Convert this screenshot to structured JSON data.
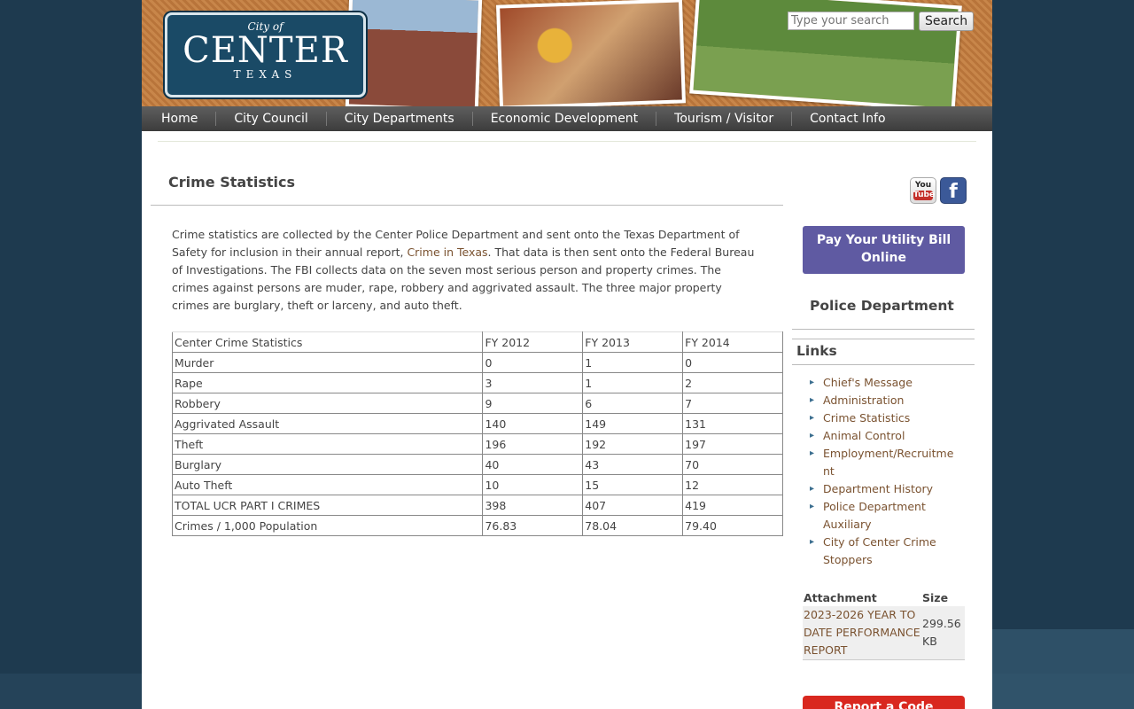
{
  "header": {
    "logo": {
      "city_of": "City of",
      "center": "CENTER",
      "texas": "TEXAS"
    },
    "search_placeholder": "Type your search",
    "search_button": "Search"
  },
  "nav": [
    "Home",
    "City Council",
    "City Departments",
    "Economic Development",
    "Tourism / Visitor",
    "Contact Info"
  ],
  "main": {
    "title": "Crime Statistics",
    "intro_part1": "Crime statistics are collected by the Center Police Department and sent onto the Texas Department of Safety for inclusion in their annual report, ",
    "intro_link": "Crime in Texas",
    "intro_part2": ".  That data is then sent onto the Federal Bureau of Investigations.  The FBI collects data on the seven most serious person and property crimes.  The crimes against persons are muder, rape, robbery and aggrivated assault.  The three major property crimes are burglary, theft or larceny, and auto theft.",
    "table": {
      "header": [
        "Center Crime Statistics",
        "FY 2012",
        "FY 2013",
        "FY 2014"
      ],
      "rows": [
        [
          "Murder",
          "0",
          "1",
          "0"
        ],
        [
          "Rape",
          "3",
          "1",
          "2"
        ],
        [
          "Robbery",
          "9",
          "6",
          "7"
        ],
        [
          "Aggrivated Assault",
          "140",
          "149",
          "131"
        ],
        [
          "Theft",
          "196",
          "192",
          "197"
        ],
        [
          "Burglary",
          "40",
          "43",
          "70"
        ],
        [
          "Auto Theft",
          "10",
          "15",
          "12"
        ],
        [
          "TOTAL UCR PART I CRIMES",
          "398",
          "407",
          "419"
        ],
        [
          "Crimes / 1,000 Population",
          "76.83",
          "78.04",
          "79.40"
        ]
      ]
    }
  },
  "sidebar": {
    "social": {
      "youtube_top": "You",
      "youtube_bottom": "Tube",
      "facebook": "f"
    },
    "pay_button": "Pay Your Utility Bill Online",
    "dept_title": "Police Department",
    "links_title": "Links",
    "links": [
      "Chief's Message",
      "Administration",
      "Crime Statistics",
      "Animal Control",
      "Employment/Recruitment",
      "Department History",
      "Police Department Auxiliary",
      "City of Center Crime Stoppers"
    ],
    "attachment": {
      "col_attachment": "Attachment",
      "col_size": "Size",
      "file_name": "2023-2026 YEAR TO DATE PERFORMANCE REPORT",
      "file_size": "299.56 KB"
    },
    "report_button": "Report a Code"
  }
}
